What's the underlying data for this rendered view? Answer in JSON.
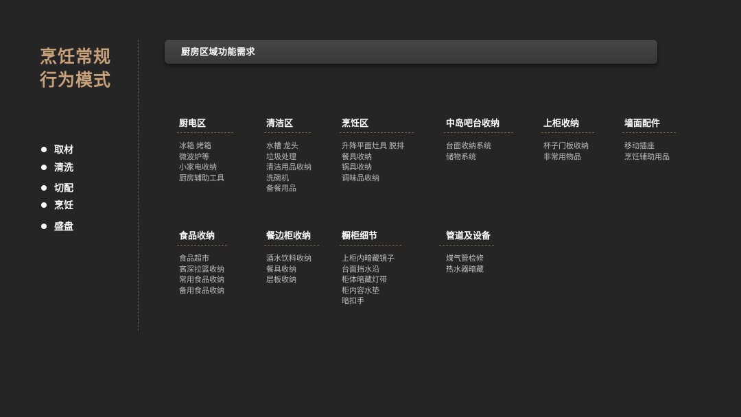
{
  "title": {
    "line1": "烹饪常规",
    "line2": "行为模式"
  },
  "steps": [
    {
      "label": "取材"
    },
    {
      "label": "清洗"
    },
    {
      "label": "切配"
    },
    {
      "label": "烹饪"
    },
    {
      "label": "盛盘"
    }
  ],
  "header": {
    "title": "厨房区域功能需求"
  },
  "sections": [
    {
      "heading": "厨电区",
      "items": [
        "冰箱 烤箱",
        "微波炉等",
        "小家电收纳",
        "厨房辅助工具"
      ]
    },
    {
      "heading": "清洁区",
      "items": [
        "水槽 龙头",
        "垃圾处理",
        "清洁用品收纳",
        "洗碗机",
        "备餐用品"
      ]
    },
    {
      "heading": "烹饪区",
      "items": [
        "升降平面灶具 脱排",
        "餐具收纳",
        "锅具收纳",
        "调味品收纳"
      ]
    },
    {
      "heading": "中岛吧台收纳",
      "items": [
        "台面收纳系统",
        "储物系统"
      ]
    },
    {
      "heading": "上柜收纳",
      "items": [
        "杯子门板收纳",
        "非常用物品"
      ]
    },
    {
      "heading": "墙面配件",
      "items": [
        "移动插座",
        "烹饪辅助用品"
      ]
    },
    {
      "heading": "食品收纳",
      "items": [
        "食品超市",
        "高深拉篮收纳",
        "常用食品收纳",
        "备用食品收纳"
      ]
    },
    {
      "heading": "餐边柜收纳",
      "items": [
        "酒水饮料收纳",
        "餐具收纳",
        "层板收纳"
      ]
    },
    {
      "heading": "橱柜细节",
      "items": [
        "上柜内暗藏镜子",
        "台面挡水沿",
        "柜体暗藏灯带",
        "柜内容水垫",
        "暗扣手"
      ]
    },
    {
      "heading": "管道及设备",
      "items": [
        "煤气管检修",
        "热水器暗藏"
      ]
    }
  ],
  "colors": {
    "background": "#252525",
    "accent": "#c8a27a",
    "divider": "#7d6a55",
    "text": "#ffffff",
    "muted": "#bdbdbd"
  }
}
